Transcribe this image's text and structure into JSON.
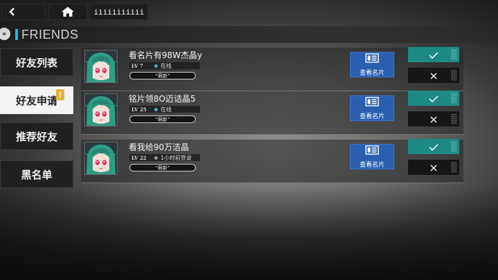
{
  "topbar": {
    "back_icon": "back-arrow-icon",
    "home_icon": "home-icon",
    "menu_label": "iiiiiiiiiii"
  },
  "header": {
    "title": "FRIENDS",
    "expand_icon": "double-chevron-right-icon"
  },
  "tabs": [
    {
      "label": "好友列表",
      "active": false
    },
    {
      "label": "好友申请",
      "active": true,
      "badge": "!"
    },
    {
      "label": "推荐好友",
      "active": false
    },
    {
      "label": "黑名单",
      "active": false
    }
  ],
  "requests": [
    {
      "name": "看名片有98W杰晶y",
      "level": "LV 7",
      "status": "在线",
      "status_color": "#3ab0d0",
      "tag": "“萌新”",
      "card_label": "查看名片"
    },
    {
      "name": "铭片领8O迈诘晶5",
      "level": "LV 25",
      "status": "在线",
      "status_color": "#3ab0d0",
      "tag": "“萌新”",
      "card_label": "查看名片"
    },
    {
      "name": "看我给90万洁晶",
      "level": "LV 22",
      "status": "1小时前登录",
      "status_color": "#9a9a9a",
      "tag": "“萌新”",
      "card_label": "查看名片"
    }
  ],
  "colors": {
    "accent": "#3ab0d0",
    "accept": "#1e8a86",
    "card_button": "#2a5fb0",
    "badge": "#e7b23a"
  }
}
